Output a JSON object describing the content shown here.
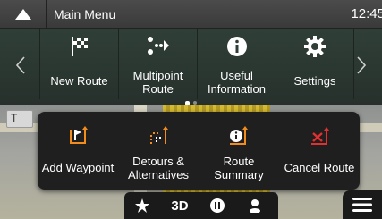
{
  "header": {
    "title": "Main Menu",
    "clock": "12:45"
  },
  "main_menu": {
    "items": [
      {
        "label": "New Route",
        "icon": "checkered-flag-icon"
      },
      {
        "label": "Multipoint\nRoute",
        "icon": "multipoint-route-icon"
      },
      {
        "label": "Useful\nInformation",
        "icon": "info-icon"
      },
      {
        "label": "Settings",
        "icon": "gear-icon"
      }
    ],
    "page_count": 2,
    "current_page": 1
  },
  "map": {
    "tile_text": "T"
  },
  "route_popup": {
    "items": [
      {
        "label": "Add Waypoint",
        "icon": "add-waypoint-icon"
      },
      {
        "label": "Detours &\nAlternatives",
        "icon": "detours-icon"
      },
      {
        "label": "Route\nSummary",
        "icon": "route-summary-icon"
      },
      {
        "label": "Cancel Route",
        "icon": "cancel-route-icon"
      }
    ]
  },
  "bottom_bar": {
    "view_label": "3D",
    "icons": [
      "star-icon",
      "pause-icon",
      "person-icon"
    ]
  },
  "colors": {
    "accent_orange": "#f28c1c",
    "cancel_red": "#e03030",
    "panel_green": "#2f3f37",
    "popup_bg": "#1f1f1f"
  }
}
